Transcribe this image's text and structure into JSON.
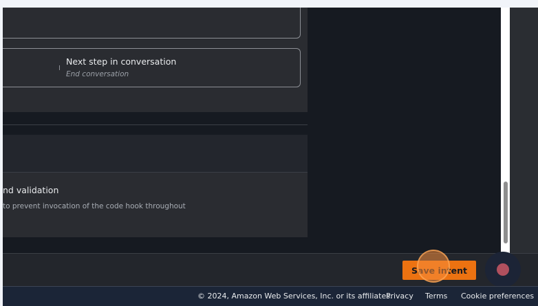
{
  "conversation_card": {
    "next_step_label": "Next step in conversation",
    "next_step_value": "End conversation"
  },
  "code_hook_section": {
    "title": "nd validation",
    "description": "to prevent invocation of the code hook throughout"
  },
  "actions": {
    "save_label": "Save intent",
    "accent_color": "#ec7211"
  },
  "footer": {
    "copyright": "© 2024, Amazon Web Services, Inc. or its affiliates.",
    "links": [
      "Privacy",
      "Terms",
      "Cookie preferences"
    ]
  }
}
